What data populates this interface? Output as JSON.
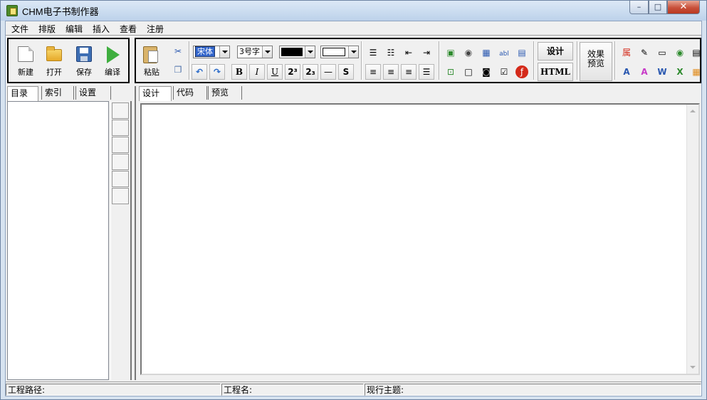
{
  "window": {
    "title": "CHM电子书制作器",
    "min_label": "–",
    "max_label": "□",
    "close_label": "✕"
  },
  "menu": [
    "文件",
    "排版",
    "编辑",
    "插入",
    "查看",
    "注册"
  ],
  "toolbar_left": [
    {
      "label": "新建",
      "icon": "new-file-icon"
    },
    {
      "label": "打开",
      "icon": "folder-open-icon"
    },
    {
      "label": "保存",
      "icon": "floppy-disk-icon"
    },
    {
      "label": "编译",
      "icon": "play-arrow-icon"
    }
  ],
  "toolbar_main": {
    "paste_label": "粘贴",
    "font_name": "宋体",
    "font_size": "3号字",
    "fore_color": "#000000",
    "back_color": "#FFFFFF",
    "design_btn": "设计",
    "html_btn": "HTML",
    "preview_btn_line1": "效果",
    "preview_btn_line2": "预览",
    "format_btns": {
      "bold": "B",
      "italic": "I",
      "underline": "U",
      "sup": "2³",
      "sub": "2₃",
      "hr": "—",
      "strike": "S"
    }
  },
  "left_tabs": [
    "目录",
    "索引",
    "设置"
  ],
  "editor_tabs": [
    "设计",
    "代码",
    "预览"
  ],
  "status": {
    "path_label": "工程路径:",
    "name_label": "工程名:",
    "topic_label": "现行主题:"
  }
}
